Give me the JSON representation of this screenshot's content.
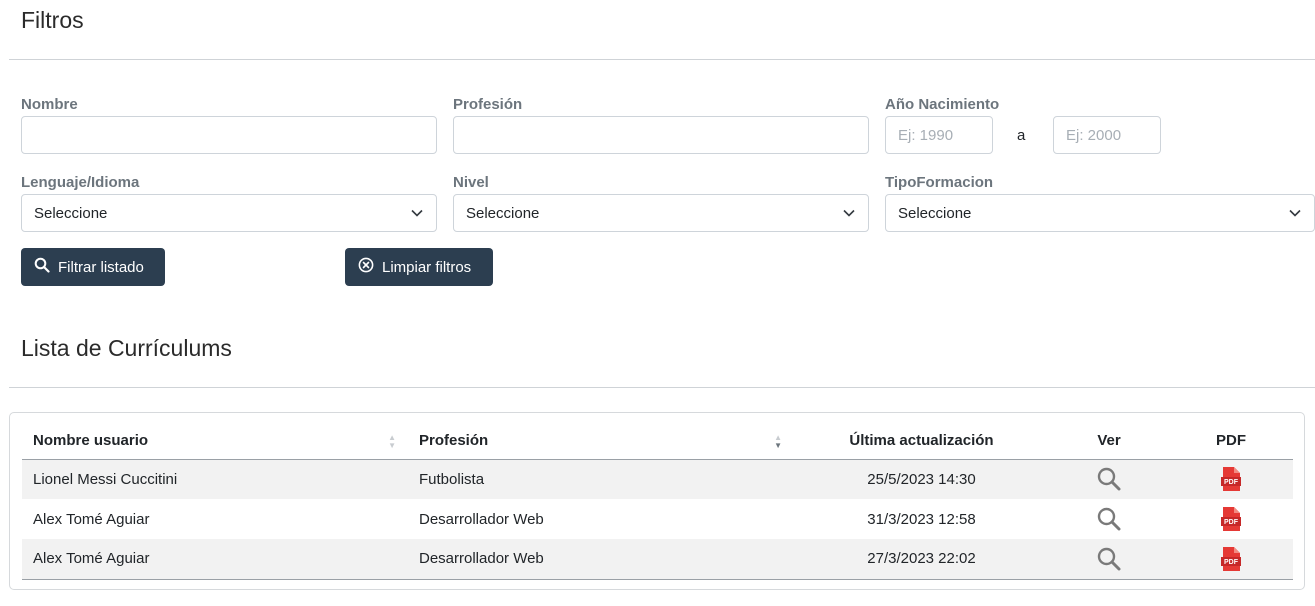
{
  "filters": {
    "title": "Filtros",
    "nombre": {
      "label": "Nombre",
      "value": "",
      "placeholder": ""
    },
    "profesion": {
      "label": "Profesión",
      "value": "",
      "placeholder": ""
    },
    "ano_nacimiento": {
      "label": "Año Nacimiento",
      "from_placeholder": "Ej: 1990",
      "separator": "a",
      "to_placeholder": "Ej: 2000"
    },
    "lenguaje": {
      "label": "Lenguaje/Idioma",
      "selected": "Seleccione"
    },
    "nivel": {
      "label": "Nivel",
      "selected": "Seleccione"
    },
    "tipo_formacion": {
      "label": "TipoFormacion",
      "selected": "Seleccione"
    },
    "filter_button": "Filtrar listado",
    "clear_button": "Limpiar filtros"
  },
  "list": {
    "title": "Lista de Currículums",
    "columns": [
      "Nombre usuario",
      "Profesión",
      "Última actualización",
      "Ver",
      "PDF"
    ],
    "rows": [
      {
        "nombre": "Lionel Messi Cuccitini",
        "profesion": "Futbolista",
        "actualizacion": "25/5/2023 14:30",
        "ver_icon": "search-icon",
        "pdf_icon": "pdf-icon"
      },
      {
        "nombre": "Alex Tomé Aguiar",
        "profesion": "Desarrollador Web",
        "actualizacion": "31/3/2023 12:58",
        "ver_icon": "search-icon",
        "pdf_icon": "pdf-icon"
      },
      {
        "nombre": "Alex Tomé Aguiar",
        "profesion": "Desarrollador Web",
        "actualizacion": "27/3/2023 22:02",
        "ver_icon": "search-icon",
        "pdf_icon": "pdf-icon"
      }
    ]
  },
  "colors": {
    "button_bg": "#2c3e50",
    "label": "#6c757d",
    "pdf_red": "#e53935",
    "zebra": "#f2f2f2"
  }
}
